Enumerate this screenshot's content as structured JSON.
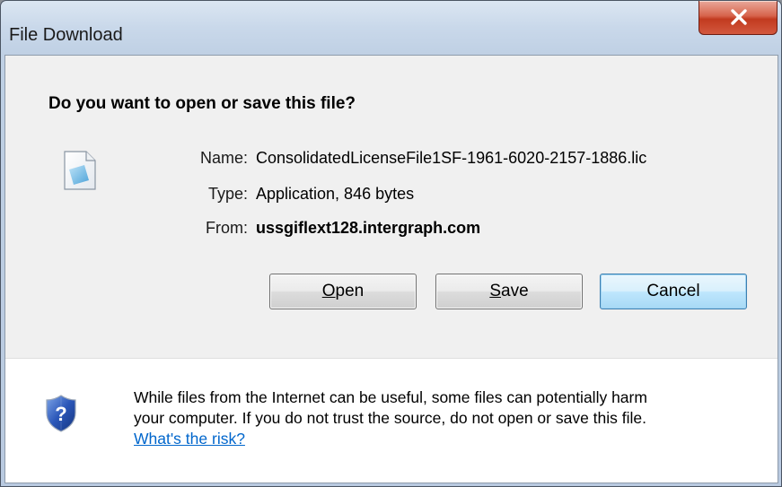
{
  "window": {
    "title": "File Download"
  },
  "dialog": {
    "question": "Do you want to open or save this file?",
    "file": {
      "name_label": "Name:",
      "name_value": "ConsolidatedLicenseFile1SF-1961-6020-2157-1886.lic",
      "type_label": "Type:",
      "type_value": "Application, 846 bytes",
      "from_label": "From:",
      "from_value": "ussgiflext128.intergraph.com"
    },
    "buttons": {
      "open_mnemonic": "O",
      "open_rest": "pen",
      "save_mnemonic": "S",
      "save_rest": "ave",
      "cancel": "Cancel"
    },
    "warning": {
      "line1": "While files from the Internet can be useful, some files can potentially harm",
      "line2": "your computer. If you do not trust the source, do not open or save this file.",
      "link": "What's the risk?"
    }
  },
  "icons": {
    "close": "close-icon",
    "file": "file-icon",
    "shield": "shield-question-icon"
  },
  "colors": {
    "link": "#0066cc",
    "close_button": "#c23a1f",
    "default_button_border": "#3c7fb1"
  }
}
